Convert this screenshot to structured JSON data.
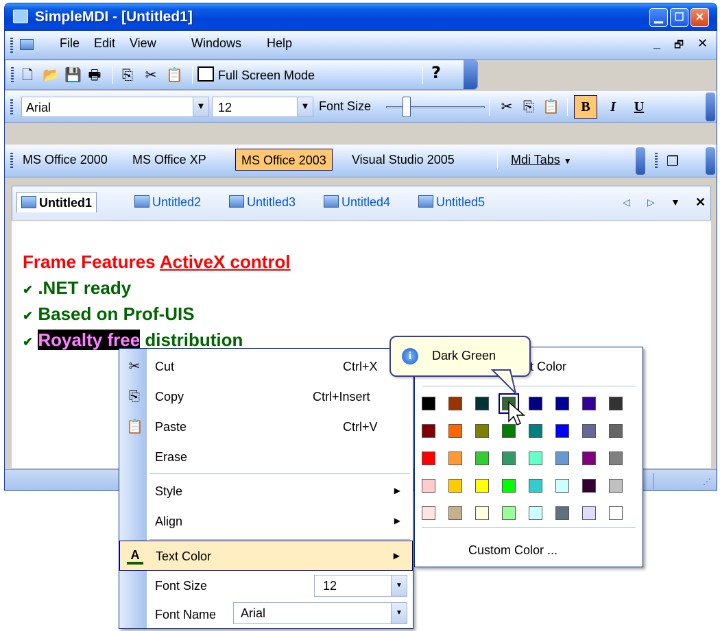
{
  "window": {
    "title": "SimpleMDI - [Untitled1]",
    "caption_buttons": [
      "minimize",
      "maximize",
      "close"
    ]
  },
  "menubar": {
    "items": [
      {
        "label": "File"
      },
      {
        "label": "Edit"
      },
      {
        "label": "View"
      },
      {
        "label": "Windows"
      },
      {
        "label": "Help"
      }
    ],
    "mdi_buttons": [
      "_",
      "🗗",
      "✕"
    ]
  },
  "toolbar": {
    "icons": [
      "new-file-icon",
      "open-folder-icon",
      "save-icon",
      "print-icon",
      "copy-icon",
      "cut-icon",
      "paste-icon"
    ],
    "full_screen_label": "Full Screen Mode",
    "help_icon": "help-icon"
  },
  "format_toolbar": {
    "font_name": "Arial",
    "font_size": "12",
    "font_size_label": "Font Size",
    "bold": "B",
    "italic": "I",
    "underline": "U"
  },
  "themes": {
    "items": [
      "MS Office 2000",
      "MS Office XP",
      "MS Office 2003",
      "Visual Studio 2005"
    ],
    "selected": "MS Office 2003",
    "mdi_tabs": "Mdi Tabs"
  },
  "tabs": {
    "items": [
      "Untitled1",
      "Untitled2",
      "Untitled3",
      "Untitled4",
      "Untitled5"
    ],
    "active": "Untitled1"
  },
  "document": {
    "heading_prefix": "Frame Features ",
    "heading_link": "ActiveX control",
    "bullets": [
      ".NET ready",
      "Based on Prof-UIS"
    ],
    "bullet3_highlight": "Royalty free",
    "bullet3_rest": " distribution",
    "colors": {
      "heading": "#ff0000",
      "bullet": "#006400",
      "highlight_bg": "#000000",
      "highlight_fg": "#ff80ff"
    }
  },
  "context_menu": {
    "cut": {
      "label": "Cut",
      "shortcut": "Ctrl+X"
    },
    "copy": {
      "label": "Copy",
      "shortcut": "Ctrl+Insert"
    },
    "paste": {
      "label": "Paste",
      "shortcut": "Ctrl+V"
    },
    "erase": {
      "label": "Erase"
    },
    "style": {
      "label": "Style"
    },
    "align": {
      "label": "Align"
    },
    "text_color": {
      "label": "Text Color"
    },
    "font_size": {
      "label": "Font Size",
      "value": "12"
    },
    "font_name": {
      "label": "Font Name",
      "value": "Arial"
    }
  },
  "color_popup": {
    "header": "Text Color",
    "header_visible_part": "t Color",
    "custom": "Custom Color ...",
    "tooltip": "Dark Green",
    "selected_index": 3,
    "swatches": [
      "#000000",
      "#993300",
      "#003333",
      "#336633",
      "#000080",
      "#000099",
      "#330099",
      "#333333",
      "#800000",
      "#ff6600",
      "#808000",
      "#008000",
      "#008080",
      "#0000ff",
      "#666699",
      "#666666",
      "#ff0000",
      "#ff9933",
      "#33cc33",
      "#339966",
      "#66ffcc",
      "#6699cc",
      "#800080",
      "#808080",
      "#ffcccc",
      "#ffcc00",
      "#ffff00",
      "#00ff00",
      "#33cccc",
      "#ccffff",
      "#330033",
      "#c0c0c0",
      "#ffe4e1",
      "#c8b08c",
      "#ffffe0",
      "#99ff99",
      "#ccffff",
      "#607080",
      "#ddddff",
      "#ffffff"
    ]
  }
}
